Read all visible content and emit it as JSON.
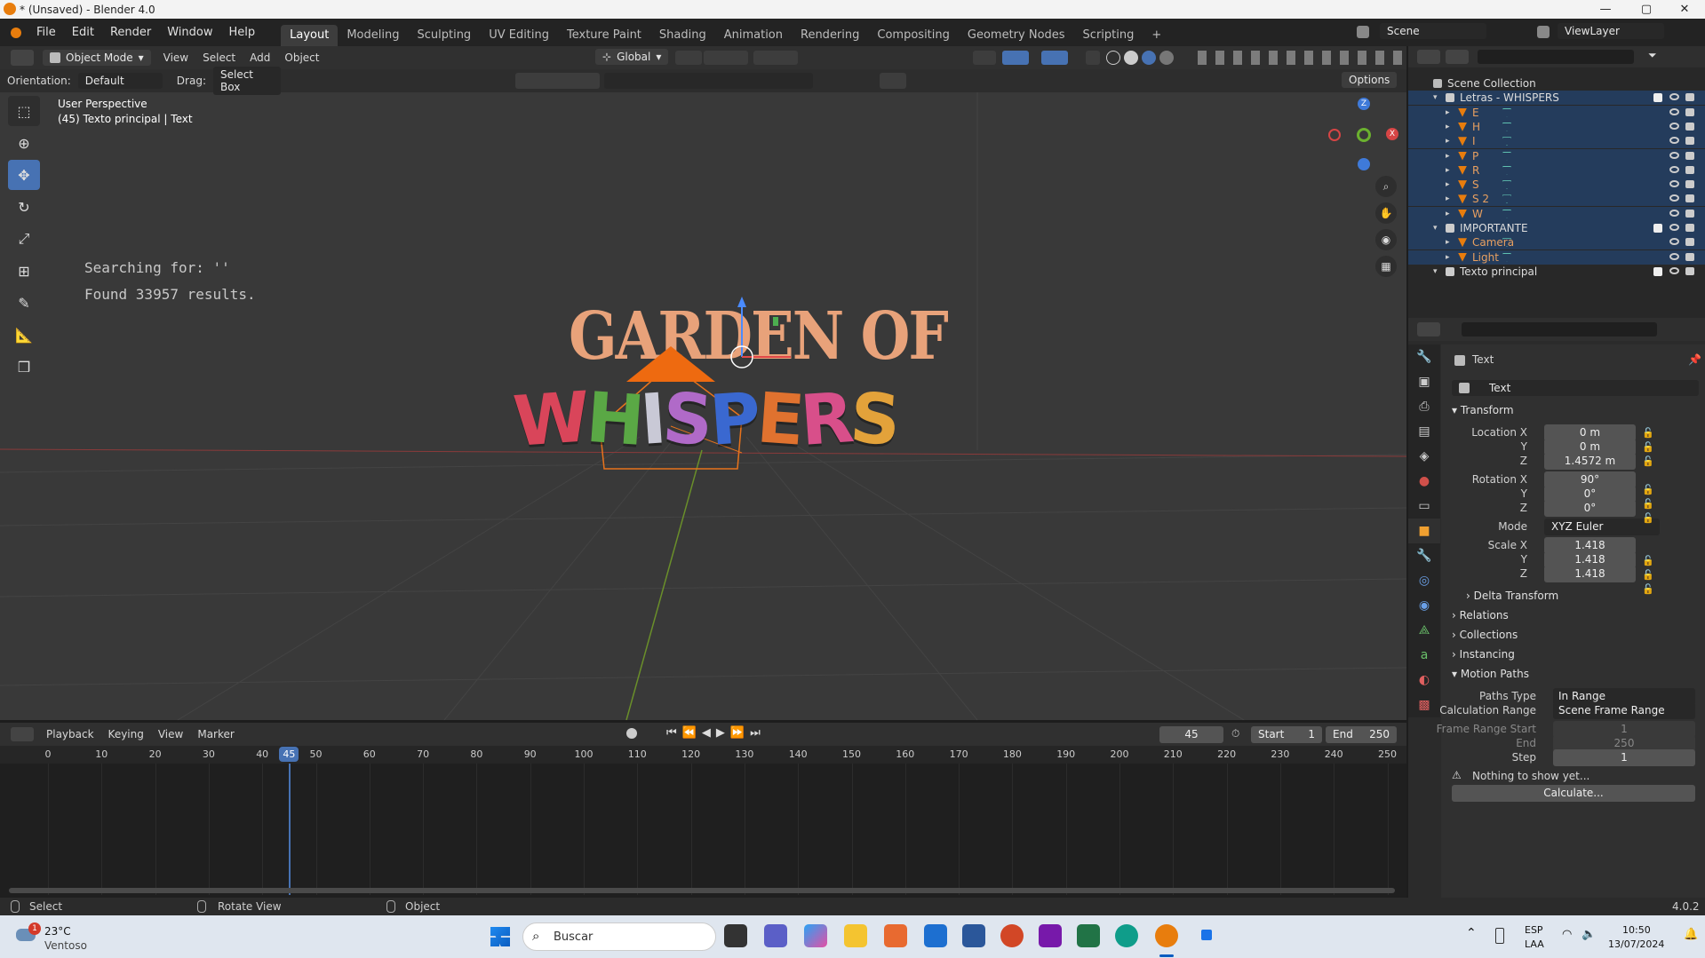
{
  "window": {
    "title": "* (Unsaved) - Blender 4.0",
    "minimize": "—",
    "maximize": "▢",
    "close": "✕"
  },
  "menu": {
    "items": [
      "File",
      "Edit",
      "Render",
      "Window",
      "Help"
    ]
  },
  "workspaces": {
    "tabs": [
      "Layout",
      "Modeling",
      "Sculpting",
      "UV Editing",
      "Texture Paint",
      "Shading",
      "Animation",
      "Rendering",
      "Compositing",
      "Geometry Nodes",
      "Scripting"
    ],
    "add": "+"
  },
  "scene": {
    "name": "Scene",
    "view_layer": "ViewLayer"
  },
  "viewport_header": {
    "mode": "Object Mode",
    "menus": [
      "View",
      "Select",
      "Add",
      "Object"
    ],
    "transform": "Global"
  },
  "tool_settings": {
    "orientation_label": "Orientation:",
    "orientation": "Default",
    "drag_label": "Drag:",
    "drag": "Select Box",
    "options": "Options"
  },
  "viewport": {
    "perspective": "User Perspective",
    "object_info": "(45) Texto principal | Text",
    "search_line1": "Searching for: ''",
    "search_line2": "Found 33957 results.",
    "title_top": "GARDEN OF",
    "title_letters": [
      "W",
      "H",
      "I",
      "S",
      "P",
      "E",
      "R",
      "S"
    ],
    "letter_colors": [
      "#d9455a",
      "#5aa845",
      "#c9c9d6",
      "#b06ac8",
      "#3a68d0",
      "#e0722f",
      "#d84f8a",
      "#e3a23a"
    ],
    "axis_x": "X",
    "axis_y": "Y",
    "axis_z": "Z"
  },
  "outliner": {
    "root": "Scene Collection",
    "collections": [
      {
        "name": "Letras - WHISPERS",
        "items": [
          "E",
          "H",
          "I",
          "P",
          "R",
          "S",
          "S 2",
          "W"
        ]
      },
      {
        "name": "IMPORTANTE",
        "items": [
          "Camera",
          "Light"
        ]
      },
      {
        "name": "Texto principal",
        "items": []
      }
    ]
  },
  "properties": {
    "object_name": "Text",
    "data_name": "Text",
    "transform": {
      "header": "Transform",
      "location_label": "Location X",
      "location": [
        "0 m",
        "0 m",
        "1.4572 m"
      ],
      "rotation_label": "Rotation X",
      "rotation": [
        "90°",
        "0°",
        "0°"
      ],
      "mode_label": "Mode",
      "mode": "XYZ Euler",
      "scale_label": "Scale X",
      "scale": [
        "1.418",
        "1.418",
        "1.418"
      ],
      "y": "Y",
      "z": "Z"
    },
    "sections": [
      "Delta Transform",
      "Relations",
      "Collections",
      "Instancing",
      "Motion Paths"
    ],
    "motion_paths": {
      "paths_type_label": "Paths Type",
      "paths_type": "In Range",
      "calc_range_label": "Calculation Range",
      "calc_range": "Scene Frame Range",
      "frame_start_label": "Frame Range Start",
      "frame_start": "1",
      "end_label": "End",
      "end": "250",
      "step_label": "Step",
      "step": "1",
      "warning": "Nothing to show yet...",
      "calculate": "Calculate..."
    }
  },
  "timeline": {
    "menus": [
      "Playback",
      "Keying",
      "View",
      "Marker"
    ],
    "current_frame": "45",
    "start_label": "Start",
    "start": "1",
    "end_label": "End",
    "end": "250",
    "ticks": [
      "0",
      "10",
      "20",
      "30",
      "40",
      "45",
      "50",
      "60",
      "70",
      "80",
      "90",
      "100",
      "110",
      "120",
      "130",
      "140",
      "150",
      "160",
      "170",
      "180",
      "190",
      "200",
      "210",
      "220",
      "230",
      "240",
      "250"
    ]
  },
  "statusbar": {
    "select": "Select",
    "rotate": "Rotate View",
    "object": "Object",
    "version": "4.0.2"
  },
  "taskbar": {
    "weather_temp": "23°C",
    "weather_desc": "Ventoso",
    "weather_badge": "1",
    "search": "Buscar",
    "lang": "ESP",
    "layout": "LAA",
    "time": "10:50",
    "date": "13/07/2024"
  },
  "colors": {
    "accent": "#4772b3",
    "selected_row": "#243c5c",
    "active_frame": "#4772b3"
  }
}
